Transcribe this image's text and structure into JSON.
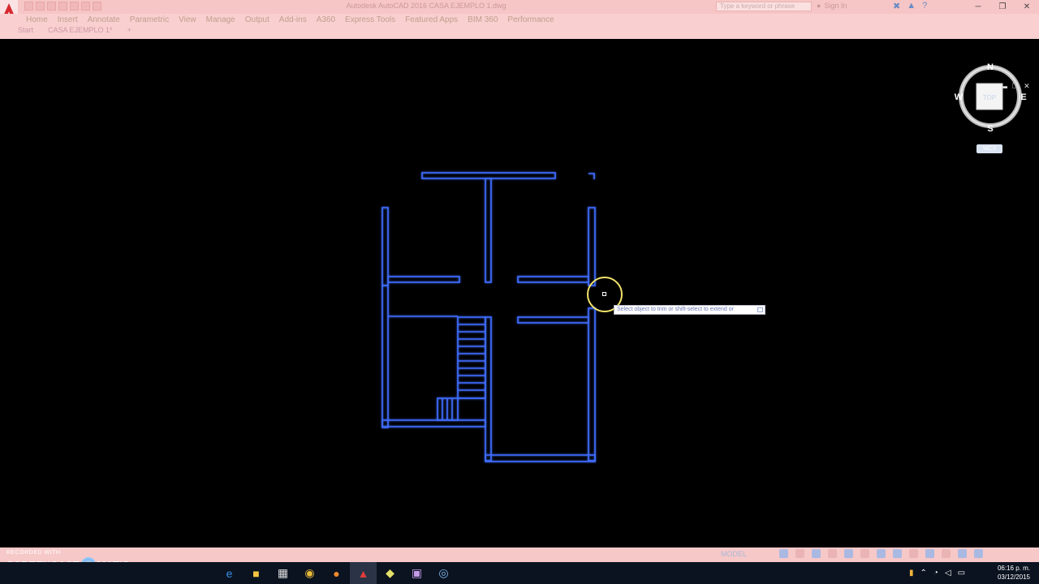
{
  "window": {
    "title": "Autodesk AutoCAD 2016   CASA EJEMPLO 1.dwg",
    "search_placeholder": "Type a keyword or phrase",
    "account_label": "Sign In",
    "minimize": "─",
    "maximize": "❐",
    "close": "✕"
  },
  "ribbon": {
    "tabs": [
      "Home",
      "Insert",
      "Annotate",
      "Parametric",
      "View",
      "Manage",
      "Output",
      "Add-ins",
      "A360",
      "Express Tools",
      "Featured Apps",
      "BIM 360",
      "Performance"
    ],
    "row2": [
      "Start",
      "CASA EJEMPLO 1*",
      "+"
    ]
  },
  "viewport": {
    "controls": [
      "▬",
      "❐",
      "✕"
    ],
    "viewcube": {
      "face": "TOP",
      "north": "N",
      "south": "S",
      "east": "E",
      "west": "W",
      "wcs_label": "WCS"
    }
  },
  "prompt": {
    "text": "Select object to trim or shift-select to extend or"
  },
  "statusbar": {
    "model_label": "MODEL"
  },
  "watermark": {
    "recorded_with": "RECORDED WITH",
    "brand_left": "SCREENCAST",
    "brand_right": "MATIC"
  },
  "taskbar": {
    "time": "06:16 p. m.",
    "date": "03/12/2015"
  },
  "colors": {
    "wall_stroke": "#3f6dff",
    "wall_glow": "#1a3cff",
    "ribbon_bg": "#f9cfcf",
    "cursor_ring": "#f1e36a"
  }
}
